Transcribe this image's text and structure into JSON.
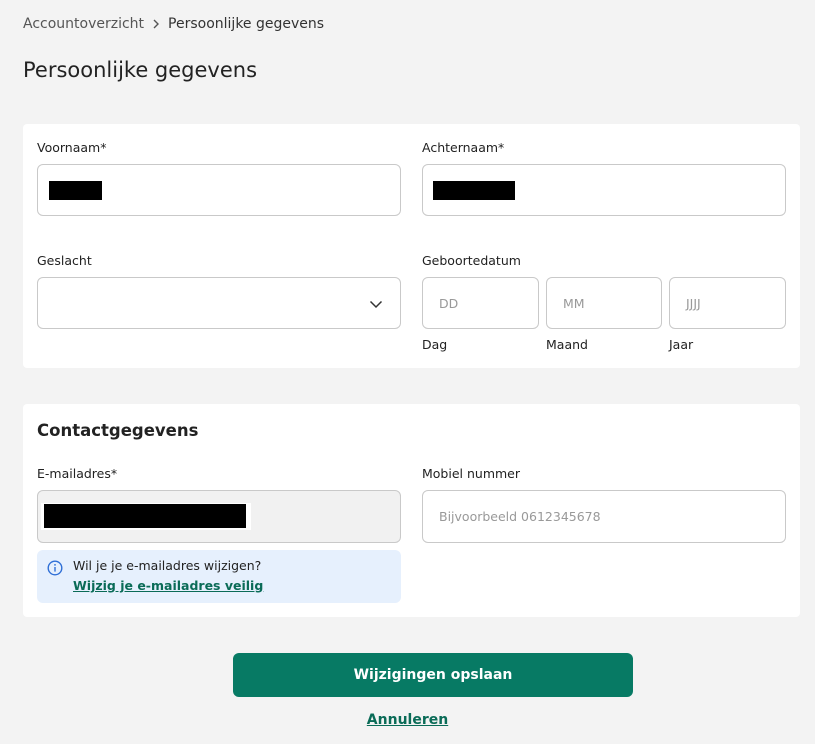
{
  "breadcrumb": {
    "parent": "Accountoverzicht",
    "current": "Persoonlijke gegevens"
  },
  "page_title": "Persoonlijke gegevens",
  "personal": {
    "first_name_label": "Voornaam*",
    "last_name_label": "Achternaam*",
    "gender_label": "Geslacht",
    "gender_value": "",
    "birthdate_label": "Geboortedatum",
    "day_placeholder": "DD",
    "month_placeholder": "MM",
    "year_placeholder": "JJJJ",
    "day_label": "Dag",
    "month_label": "Maand",
    "year_label": "Jaar"
  },
  "contact": {
    "section_title": "Contactgegevens",
    "email_label": "E-mailadres*",
    "mobile_label": "Mobiel nummer",
    "mobile_placeholder": "Bijvoorbeeld 0612345678",
    "info_text": "Wil je je e-mailadres wijzigen?",
    "info_link": "Wijzig je e-mailadres veilig"
  },
  "actions": {
    "save_label": "Wijzigingen opslaan",
    "cancel_label": "Annuleren"
  },
  "colors": {
    "primary": "#077a64",
    "link": "#0a6b57",
    "info_bg": "#e6f0fd",
    "info_icon": "#2f6fd6",
    "page_bg": "#f3f3f3"
  },
  "icons": {
    "breadcrumb_separator": "chevron-right-icon",
    "gender_dropdown": "chevron-down-icon",
    "info": "info-icon"
  }
}
